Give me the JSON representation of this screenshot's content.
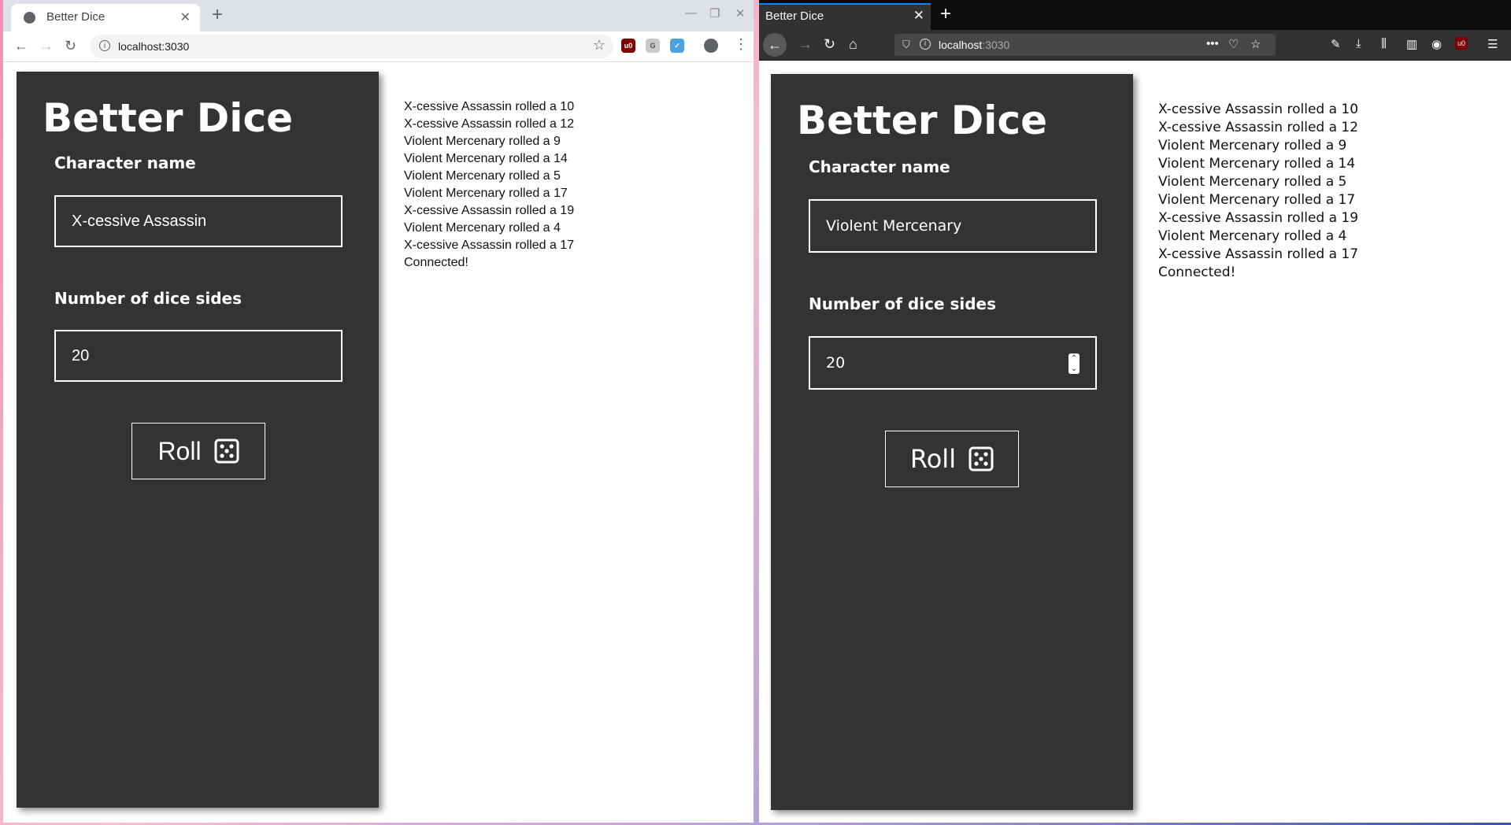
{
  "left_browser": {
    "tab_title": "Better Dice",
    "url": "localhost:3030",
    "app": {
      "title": "Better Dice",
      "character_label": "Character name",
      "character_value": "X-cessive Assassin",
      "sides_label": "Number of dice sides",
      "sides_value": "20",
      "roll_label": "Roll"
    },
    "log": [
      "X-cessive Assassin rolled a 10",
      "X-cessive Assassin rolled a 12",
      "Violent Mercenary rolled a 9",
      "Violent Mercenary rolled a 14",
      "Violent Mercenary rolled a 5",
      "Violent Mercenary rolled a 17",
      "X-cessive Assassin rolled a 19",
      "Violent Mercenary rolled a 4",
      "X-cessive Assassin rolled a 17",
      "Connected!"
    ]
  },
  "right_browser": {
    "tab_title": "Better Dice",
    "url_host": "localhost",
    "url_port": ":3030",
    "app": {
      "title": "Better Dice",
      "character_label": "Character name",
      "character_value": "Violent Mercenary",
      "sides_label": "Number of dice sides",
      "sides_value": "20",
      "roll_label": "Roll"
    },
    "log": [
      "X-cessive Assassin rolled a 10",
      "X-cessive Assassin rolled a 12",
      "Violent Mercenary rolled a 9",
      "Violent Mercenary rolled a 14",
      "Violent Mercenary rolled a 5",
      "Violent Mercenary rolled a 17",
      "X-cessive Assassin rolled a 19",
      "Violent Mercenary rolled a 4",
      "X-cessive Assassin rolled a 17",
      "Connected!"
    ]
  },
  "icons": {
    "dice": "dice-five-icon",
    "ublock": "ublock-icon"
  },
  "colors": {
    "panel_bg": "#333333",
    "panel_text": "#ffffff",
    "firefox_accent": "#0a84ff"
  }
}
